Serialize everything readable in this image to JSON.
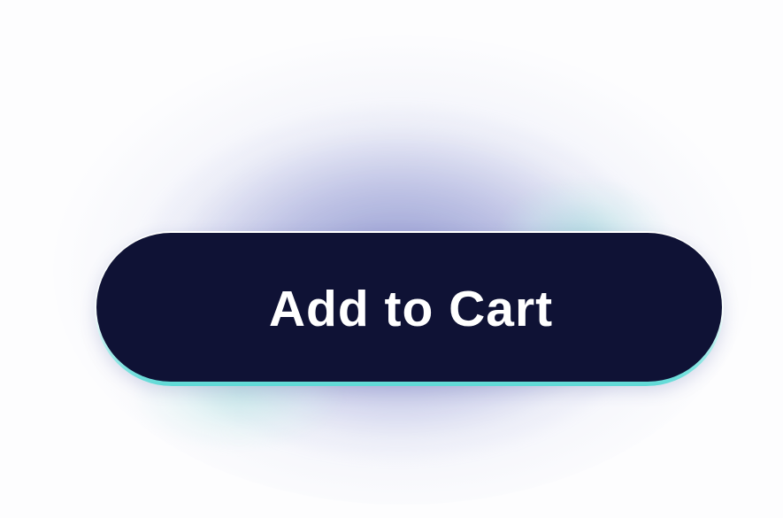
{
  "button": {
    "label": "Add to Cart"
  },
  "colors": {
    "button_fill": "#0f1235",
    "label_text": "#ffffff",
    "border_accent": "#5fd9d6",
    "glow_primary": "#4650aa",
    "glow_secondary": "#96dcd7",
    "background": "#fdfdfe"
  }
}
